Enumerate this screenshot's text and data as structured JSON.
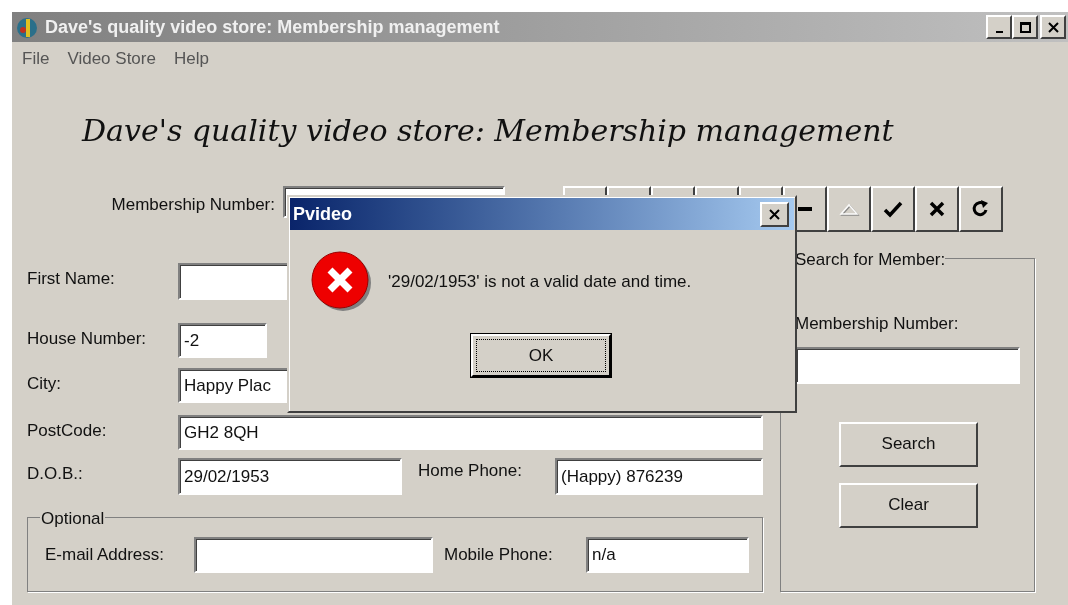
{
  "window": {
    "title": "Dave's quality video store: Membership management",
    "active": false
  },
  "menu": [
    "File",
    "Video Store",
    "Help"
  ],
  "heading": "Dave's quality video store: Membership management",
  "membership": {
    "label": "Membership Number:"
  },
  "navigator": [
    {
      "kind": "minus",
      "disabled": false
    },
    {
      "kind": "up",
      "disabled": true
    },
    {
      "kind": "check",
      "disabled": false
    },
    {
      "kind": "cross",
      "disabled": false
    },
    {
      "kind": "refresh",
      "disabled": false
    }
  ],
  "form": {
    "first_name": {
      "label": "First Name:"
    },
    "house_number": {
      "label": "House Number:",
      "value": "-2"
    },
    "city": {
      "label": "City:",
      "value": "Happy Plac"
    },
    "postcode": {
      "label": "PostCode:",
      "value": "GH2 8QH"
    },
    "dob": {
      "label": "D.O.B.:",
      "value": "29/02/1953"
    },
    "home_phone": {
      "label": "Home Phone:",
      "value": "(Happy) 876239"
    }
  },
  "optional": {
    "title": "Optional",
    "email": {
      "label": "E-mail Address:"
    },
    "mobile": {
      "label": "Mobile Phone:",
      "value": "n/a"
    }
  },
  "search_panel": {
    "title": "Search for Member:",
    "label": "Membership Number:",
    "buttons": [
      "Search",
      "Clear"
    ]
  },
  "dialog": {
    "title": "Pvideo",
    "message": "'29/02/1953' is not a valid date and time.",
    "button": "OK"
  }
}
